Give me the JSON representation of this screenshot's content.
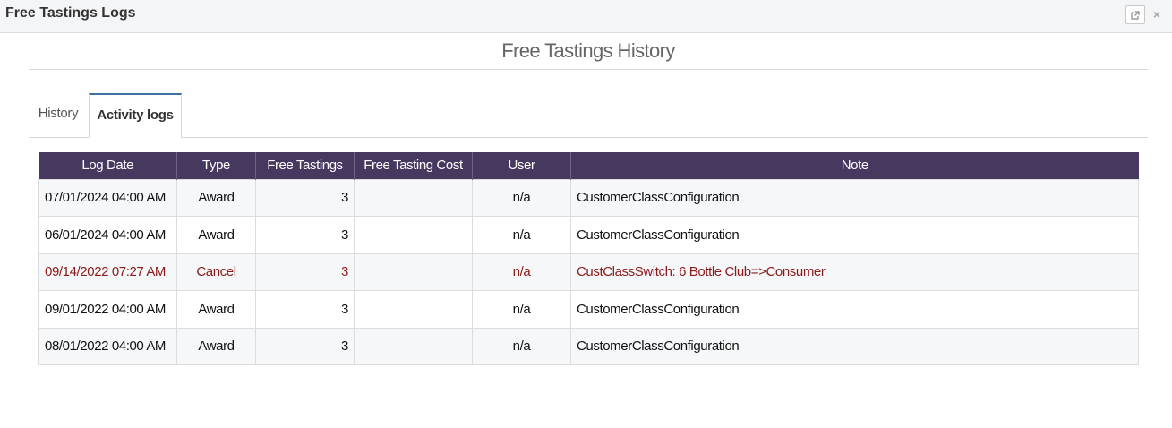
{
  "window": {
    "title": "Free Tastings Logs",
    "popout_icon": "external-link-icon",
    "close_icon": "close-icon",
    "close_glyph": "×"
  },
  "section_title": "Free Tastings History",
  "tabs": [
    {
      "label": "History",
      "active": false
    },
    {
      "label": "Activity logs",
      "active": true
    }
  ],
  "table": {
    "header_color": "#473860",
    "cancel_color": "#8b1a1a",
    "columns": [
      "Log Date",
      "Type",
      "Free Tastings",
      "Free Tasting Cost",
      "User",
      "Note"
    ],
    "rows": [
      {
        "log_date": "07/01/2024 04:00 AM",
        "type": "Award",
        "free_tastings": "3",
        "cost": "",
        "user": "n/a",
        "note": "CustomerClassConfiguration"
      },
      {
        "log_date": "06/01/2024 04:00 AM",
        "type": "Award",
        "free_tastings": "3",
        "cost": "",
        "user": "n/a",
        "note": "CustomerClassConfiguration"
      },
      {
        "log_date": "09/14/2022 07:27 AM",
        "type": "Cancel",
        "free_tastings": "3",
        "cost": "",
        "user": "n/a",
        "note": "CustClassSwitch: 6 Bottle Club=>Consumer"
      },
      {
        "log_date": "09/01/2022 04:00 AM",
        "type": "Award",
        "free_tastings": "3",
        "cost": "",
        "user": "n/a",
        "note": "CustomerClassConfiguration"
      },
      {
        "log_date": "08/01/2022 04:00 AM",
        "type": "Award",
        "free_tastings": "3",
        "cost": "",
        "user": "n/a",
        "note": "CustomerClassConfiguration"
      }
    ]
  }
}
